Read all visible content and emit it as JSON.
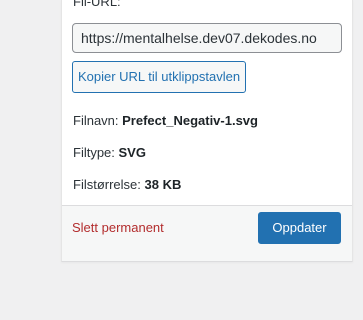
{
  "details": {
    "file_url_label": "Fil-URL:",
    "file_url_value": "https://mentalhelse.dev07.dekodes.no",
    "copy_url_label": "Kopier URL til utklippstavlen",
    "filename_label": "Filnavn:",
    "filename_value": "Prefect_Negativ-1.svg",
    "filetype_label": "Filtype:",
    "filetype_value": "SVG",
    "filesize_label": "Filstørrelse:",
    "filesize_value": "38 KB"
  },
  "actions": {
    "delete_label": "Slett permanent",
    "update_label": "Oppdater"
  },
  "colors": {
    "accent": "#2271b1",
    "danger": "#b32d2e",
    "background": "#f0f0f1",
    "panel": "#ffffff"
  }
}
